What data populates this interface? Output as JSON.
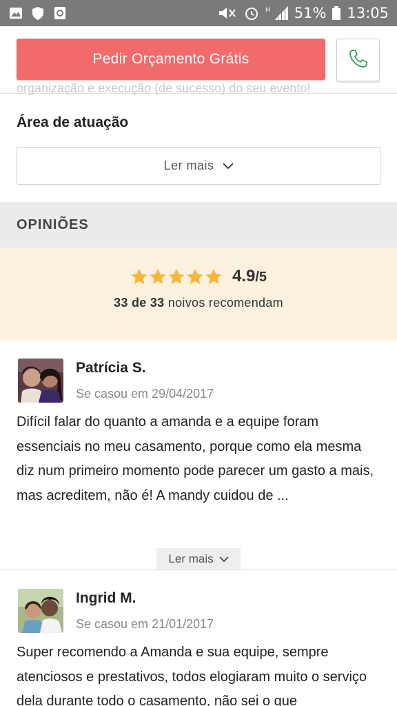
{
  "status_bar": {
    "battery_percent": "51%",
    "time": "13:05",
    "icons": [
      "image-icon",
      "shield-icon",
      "recycle-icon",
      "mute-icon",
      "alarm-icon",
      "signal-icon",
      "battery-icon"
    ]
  },
  "action_bar": {
    "quote_button_label": "Pedir Orçamento Grátis",
    "background_text": "organização e execução (de sucesso) do seu evento!"
  },
  "area": {
    "title": "Área de atuação",
    "read_more_label": "Ler mais"
  },
  "opinions": {
    "header": "OPINIÕES",
    "rating_value": "4.9",
    "rating_max": "/5",
    "stars": 5,
    "recommend_count": "33 de 33",
    "recommend_suffix": " noivos recomendam"
  },
  "reviews": [
    {
      "name": "Patrícia S.",
      "date": "Se casou em 29/04/2017",
      "text": "Difícil falar do quanto a amanda e a equipe foram essenciais no meu casamento, porque como ela mesma diz num primeiro momento pode parecer um gasto a mais, mas acreditem, não é! A mandy cuidou de ...",
      "read_more_label": "Ler mais"
    },
    {
      "name": "Ingrid M.",
      "date": "Se casou em 21/01/2017",
      "text": "Super recomendo a Amanda e sua equipe, sempre atenciosos e prestativos, todos elogiaram muito o serviço dela durante todo o casamento, não sei o que"
    }
  ],
  "colors": {
    "accent": "#f26b6b",
    "star": "#f5b73b",
    "phone_icon": "#3a9a5a",
    "rating_bg": "#fbf1de"
  }
}
